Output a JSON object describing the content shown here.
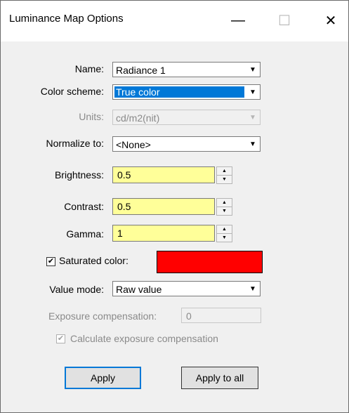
{
  "window": {
    "title": "Luminance Map Options",
    "minimize_glyph": "—",
    "maximize_glyph": "☐",
    "close_glyph": "✕"
  },
  "form": {
    "name": {
      "label": "Name:",
      "value": "Radiance 1"
    },
    "color_scheme": {
      "label": "Color scheme:",
      "value": "True color"
    },
    "units": {
      "label": "Units:",
      "value": "cd/m2(nit)"
    },
    "normalize_to": {
      "label": "Normalize to:",
      "value": "<None>"
    },
    "brightness": {
      "label": "Brightness:",
      "value": "0.5"
    },
    "contrast": {
      "label": "Contrast:",
      "value": "0.5"
    },
    "gamma": {
      "label": "Gamma:",
      "value": "1"
    },
    "saturated_color": {
      "label": "Saturated color:",
      "checked": true,
      "color": "#ff0000"
    },
    "value_mode": {
      "label": "Value mode:",
      "value": "Raw value"
    },
    "exposure_compensation": {
      "label": "Exposure compensation:",
      "value": "0"
    },
    "calculate_exposure": {
      "label": "Calculate exposure compensation",
      "checked": true
    }
  },
  "buttons": {
    "apply": "Apply",
    "apply_to_all": "Apply to all"
  },
  "icons": {
    "dropdown_arrow": "▼",
    "spin_up": "▲",
    "spin_down": "▼",
    "check": "✔"
  },
  "colors": {
    "accent": "#0078d7",
    "field_highlight": "#ffff99"
  }
}
